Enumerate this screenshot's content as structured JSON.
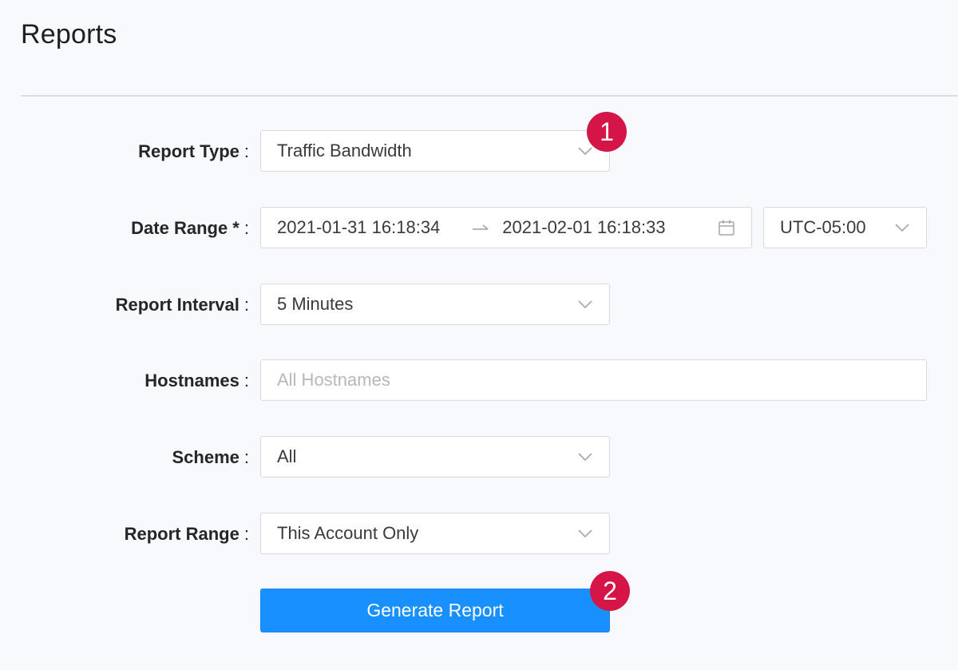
{
  "page": {
    "title": "Reports"
  },
  "form": {
    "report_type": {
      "label": "Report Type",
      "colon": ":",
      "value": "Traffic Bandwidth"
    },
    "date_range": {
      "label": "Date Range *",
      "colon": ":",
      "start": "2021-01-31 16:18:34",
      "end": "2021-02-01 16:18:33",
      "timezone": "UTC-05:00"
    },
    "report_interval": {
      "label": "Report Interval",
      "colon": ":",
      "value": "5 Minutes"
    },
    "hostnames": {
      "label": "Hostnames",
      "colon": ":",
      "placeholder": "All Hostnames"
    },
    "scheme": {
      "label": "Scheme",
      "colon": ":",
      "value": "All"
    },
    "report_range": {
      "label": "Report Range",
      "colon": ":",
      "value": "This Account Only"
    },
    "generate_label": "Generate Report"
  },
  "annotations": {
    "badge_1": "1",
    "badge_2": "2"
  },
  "icons": {
    "dropdown": "chevron-down-icon",
    "calendar": "calendar-icon",
    "range_separator": "arrow-right-icon"
  },
  "colors": {
    "primary": "#1890ff",
    "badge": "#d51548",
    "background": "#f8f9fd",
    "border": "#d9d9d9"
  }
}
